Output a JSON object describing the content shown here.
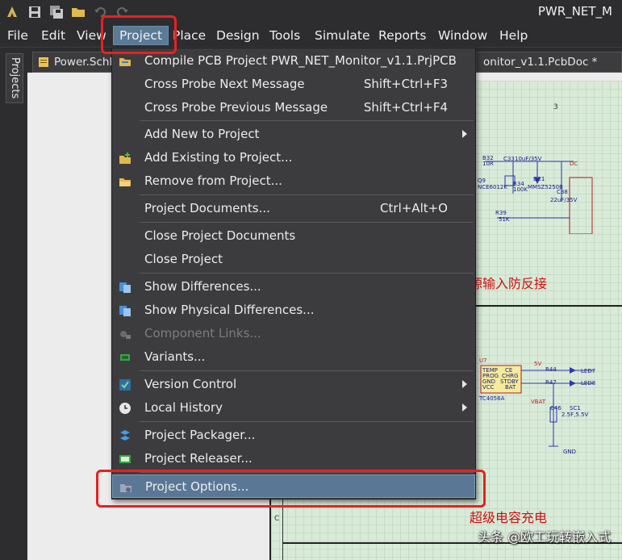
{
  "app": {
    "title": "PWR_NET_M"
  },
  "menubar": {
    "items": [
      "File",
      "Edit",
      "View",
      "Project",
      "Place",
      "Design",
      "Tools",
      "Simulate",
      "Reports",
      "Window",
      "Help"
    ]
  },
  "left_panel": {
    "projects_tab": "Projects"
  },
  "tabs": [
    {
      "label": "Power.SchDoc"
    },
    {
      "label": "onitor_v1.1.PcbDoc *"
    }
  ],
  "project_menu": {
    "items": [
      {
        "label": "Compile PCB Project PWR_NET_Monitor_v1.1.PrjPCB",
        "shortcut": "",
        "icon": "compile-icon"
      },
      {
        "label": "Cross Probe Next Message",
        "shortcut": "Shift+Ctrl+F3"
      },
      {
        "label": "Cross Probe Previous Message",
        "shortcut": "Shift+Ctrl+F4"
      },
      {
        "label": "Add New to Project",
        "submenu": true
      },
      {
        "label": "Add Existing to Project...",
        "icon": "add-existing-icon"
      },
      {
        "label": "Remove from Project...",
        "icon": "remove-folder-icon"
      },
      {
        "label": "Project Documents...",
        "shortcut": "Ctrl+Alt+O"
      },
      {
        "label": "Close Project Documents"
      },
      {
        "label": "Close Project"
      },
      {
        "label": "Show Differences...",
        "icon": "differences-icon"
      },
      {
        "label": "Show Physical Differences...",
        "icon": "physical-differences-icon"
      },
      {
        "label": "Component Links...",
        "icon": "component-links-icon",
        "disabled": true
      },
      {
        "label": "Variants...",
        "icon": "variants-icon"
      },
      {
        "label": "Version Control",
        "submenu": true,
        "icon": "version-control-icon"
      },
      {
        "label": "Local History",
        "submenu": true,
        "icon": "clock-icon"
      },
      {
        "label": "Project Packager...",
        "icon": "packager-icon"
      },
      {
        "label": "Project Releaser...",
        "icon": "releaser-icon"
      },
      {
        "label": "Project Options...",
        "icon": "options-icon",
        "highlighted": true
      }
    ]
  },
  "schematic": {
    "notes": [
      "源输入防反接",
      "超级电容充电"
    ],
    "column_label": "3",
    "row_label": "C",
    "parts": [
      "B32",
      "10R",
      "C33",
      "10uF/35V",
      "DC",
      "Q9",
      "NCE6012K",
      "R34",
      "100K",
      "D21",
      "MMSZ5250B",
      "C38",
      "22uF/35V",
      "R39",
      "51K",
      "U7",
      "TEMP",
      "PROG",
      "GND",
      "VCC",
      "CE",
      "CHRG",
      "STDBY",
      "BAT",
      "TC4056A",
      "5V",
      "R44",
      "R47",
      "LED7",
      "LED8",
      "VBAT",
      "C46",
      "SC1",
      "2.5F,5.5V",
      "GND"
    ]
  },
  "watermark": "头条 @欧工玩转嵌入式",
  "colors": {
    "menu_bg": "#3c3c3f",
    "highlight": "#5a7896",
    "annotation": "#e8211f"
  }
}
